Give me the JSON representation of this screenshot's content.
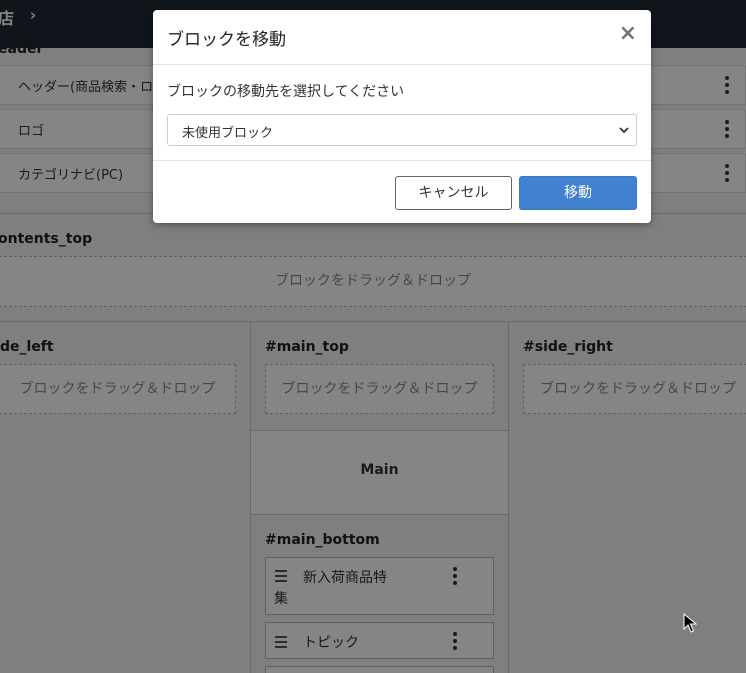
{
  "topbar": {
    "shop_fragment": "店",
    "chevron": "›"
  },
  "regions": {
    "header_title": "eader",
    "contents_top_title": "ontents_top",
    "side_left_title": "de_left",
    "main_top_title": "#main_top",
    "side_right_title": "#side_right",
    "main_bottom_title": "#main_bottom",
    "main_label": "Main"
  },
  "header_blocks": [
    {
      "label": "ヘッダー(商品検索・ロ"
    },
    {
      "label": "ロゴ"
    },
    {
      "label": "カテゴリナビ(PC)"
    }
  ],
  "dropzone_text": "ブロックをドラッグ＆ドロップ",
  "main_bottom_blocks": [
    {
      "label_line1": "新入荷商品特",
      "label_line2": "集"
    },
    {
      "label_line1": "トピック"
    }
  ],
  "modal": {
    "title": "ブロックを移動",
    "close_glyph": "×",
    "message": "ブロックの移動先を選択してください",
    "select_value": "未使用ブロック",
    "cancel_label": "キャンセル",
    "move_label": "移動"
  },
  "colors": {
    "topbar": "#1f2a36",
    "primary_button": "#4280d0",
    "overlay": "rgba(0,0,0,0.48)"
  }
}
